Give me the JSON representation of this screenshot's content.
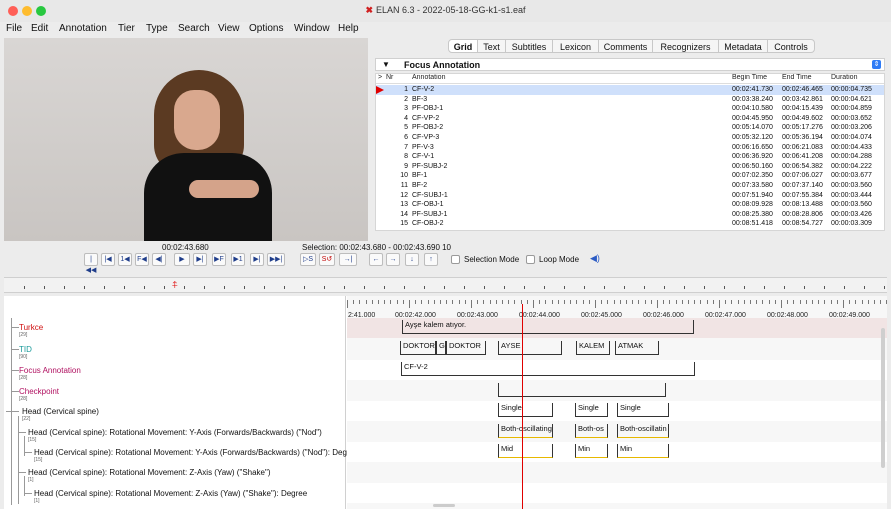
{
  "window": {
    "title": "ELAN 6.3 - 2022-05-18-GG-k1-s1.eaf",
    "app_icon": "elan-logo-icon"
  },
  "menu": [
    "File",
    "Edit",
    "Annotation",
    "Tier",
    "Type",
    "Search",
    "View",
    "Options",
    "Window",
    "Help"
  ],
  "tabs": [
    "Grid",
    "Text",
    "Subtitles",
    "Lexicon",
    "Comments",
    "Recognizers",
    "Metadata",
    "Controls"
  ],
  "active_tab": "Grid",
  "grid": {
    "tier": "Focus Annotation",
    "headers": {
      "sort": ">",
      "nr": "Nr",
      "annotation": "Annotation",
      "begin": "Begin Time",
      "end": "End Time",
      "duration": "Duration"
    },
    "rows": [
      {
        "nr": "1",
        "annotation": "CF-V-2",
        "begin": "00:02:41.730",
        "end": "00:02:46.465",
        "duration": "00:00:04.735"
      },
      {
        "nr": "2",
        "annotation": "BF-3",
        "begin": "00:03:38.240",
        "end": "00:03:42.861",
        "duration": "00:00:04.621"
      },
      {
        "nr": "3",
        "annotation": "PF-OBJ-1",
        "begin": "00:04:10.580",
        "end": "00:04:15.439",
        "duration": "00:00:04.859"
      },
      {
        "nr": "4",
        "annotation": "CF-VP-2",
        "begin": "00:04:45.950",
        "end": "00:04:49.602",
        "duration": "00:00:03.652"
      },
      {
        "nr": "5",
        "annotation": "PF-OBJ-2",
        "begin": "00:05:14.070",
        "end": "00:05:17.276",
        "duration": "00:00:03.206"
      },
      {
        "nr": "6",
        "annotation": "CF-VP-3",
        "begin": "00:05:32.120",
        "end": "00:05:36.194",
        "duration": "00:00:04.074"
      },
      {
        "nr": "7",
        "annotation": "PF-V-3",
        "begin": "00:06:16.650",
        "end": "00:06:21.083",
        "duration": "00:00:04.433"
      },
      {
        "nr": "8",
        "annotation": "CF-V-1",
        "begin": "00:06:36.920",
        "end": "00:06:41.208",
        "duration": "00:00:04.288"
      },
      {
        "nr": "9",
        "annotation": "PF-SUBJ-2",
        "begin": "00:06:50.160",
        "end": "00:06:54.382",
        "duration": "00:00:04.222"
      },
      {
        "nr": "10",
        "annotation": "BF-1",
        "begin": "00:07:02.350",
        "end": "00:07:06.027",
        "duration": "00:00:03.677"
      },
      {
        "nr": "11",
        "annotation": "BF-2",
        "begin": "00:07:33.580",
        "end": "00:07:37.140",
        "duration": "00:00:03.560"
      },
      {
        "nr": "12",
        "annotation": "CF-SUBJ-1",
        "begin": "00:07:51.940",
        "end": "00:07:55.384",
        "duration": "00:00:03.444"
      },
      {
        "nr": "13",
        "annotation": "CF-OBJ-1",
        "begin": "00:08:09.928",
        "end": "00:08:13.488",
        "duration": "00:00:03.560"
      },
      {
        "nr": "14",
        "annotation": "PF-SUBJ-1",
        "begin": "00:08:25.380",
        "end": "00:08:28.806",
        "duration": "00:00:03.426"
      },
      {
        "nr": "15",
        "annotation": "CF-OBJ-2",
        "begin": "00:08:51.418",
        "end": "00:08:54.727",
        "duration": "00:00:03.309"
      }
    ]
  },
  "media": {
    "current_time": "00:02:43.680",
    "selection": "Selection: 00:02:43.680 - 00:02:43.690  10",
    "controls": [
      "|◀◀",
      "|◀",
      "1◀",
      "F◀",
      "◀|",
      "▶",
      "▶|",
      "▶F",
      "▶1",
      "▶|",
      "▶▶|",
      "▷S",
      "S↺",
      "→|",
      "←",
      "→",
      "↓",
      "↑"
    ],
    "selection_mode": "Selection Mode",
    "loop_mode": "Loop Mode",
    "volume_icon": "speaker-icon"
  },
  "ruler": [
    "2:41.000",
    "00:02:42.000",
    "00:02:43.000",
    "00:02:44.000",
    "00:02:45.000",
    "00:02:46.000",
    "00:02:47.000",
    "00:02:48.000",
    "00:02:49.000"
  ],
  "tiers": [
    {
      "name": "Turkce",
      "count": "[29]",
      "color": "#d01010"
    },
    {
      "name": "TID",
      "count": "[90]",
      "color": "#1a9a9a"
    },
    {
      "name": "Focus Annotation",
      "count": "[28]",
      "color": "#b01060"
    },
    {
      "name": "Checkpoint",
      "count": "[28]",
      "color": "#b01060"
    },
    {
      "name": "Head (Cervical spine)",
      "count": "[22]",
      "color": "#222222"
    },
    {
      "name": "Head (Cervical spine): Rotational Movement: Y-Axis (Forwards/Backwards) (\"Nod\")",
      "count": "[15]",
      "color": "#222222"
    },
    {
      "name": "Head (Cervical spine): Rotational Movement: Y-Axis (Forwards/Backwards) (\"Nod\"): Degree",
      "count": "[15]",
      "color": "#222222"
    },
    {
      "name": "Head (Cervical spine): Rotational Movement: Z-Axis (Yaw) (\"Shake\")",
      "count": "[1]",
      "color": "#222222"
    },
    {
      "name": "Head (Cervical spine): Rotational Movement: Z-Axis (Yaw) (\"Shake\"): Degree",
      "count": "[1]",
      "color": "#222222"
    }
  ],
  "annotations": {
    "turkce": [
      "Ayşe kalem atıyor."
    ],
    "tid": [
      "DOKTOR",
      "G",
      "DOKTOR",
      "AYSE",
      "KALEM",
      "ATMAK"
    ],
    "focus": [
      "CF-V-2"
    ],
    "head": [
      "Single",
      "Single",
      "Single"
    ],
    "nod": [
      "Both-oscillating",
      "Both-os",
      "Both-oscillatin"
    ],
    "nod_degree": [
      "Mid",
      "Min",
      "Min"
    ]
  }
}
